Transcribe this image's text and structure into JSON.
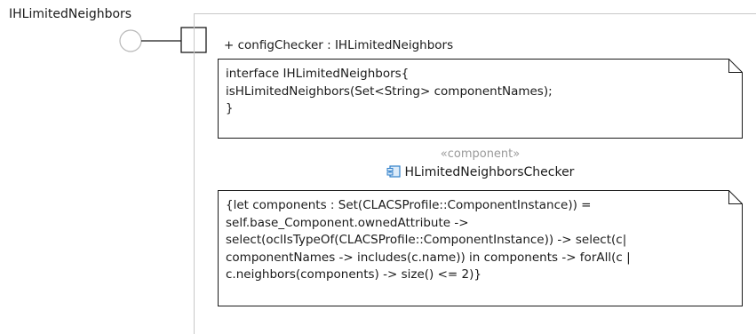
{
  "interface": {
    "name": "IHLimitedNeighbors"
  },
  "port": {
    "label": "+ configChecker : IHLimitedNeighbors"
  },
  "interface_note": {
    "text": "interface IHLimitedNeighbors{\nisHLimitedNeighbors(Set<String> componentNames);\n}"
  },
  "component": {
    "stereotype": "«component»",
    "name": "HLimitedNeighborsChecker",
    "icon": "component-icon"
  },
  "constraint_note": {
    "text": "{let components : Set(CLACSProfile::ComponentInstance)) =\nself.base_Component.ownedAttribute ->\nselect(oclIsTypeOf(CLACSProfile::ComponentInstance)) -> select(c|\ncomponentNames -> includes(c.name)) in components -> forAll(c |\nc.neighbors(components) -> size() <= 2)}"
  },
  "colors": {
    "frame": "#c8c8c8",
    "outline": "#1a1a1a",
    "icon": "#2f7fc9",
    "stereotype": "#9a9a9a"
  }
}
